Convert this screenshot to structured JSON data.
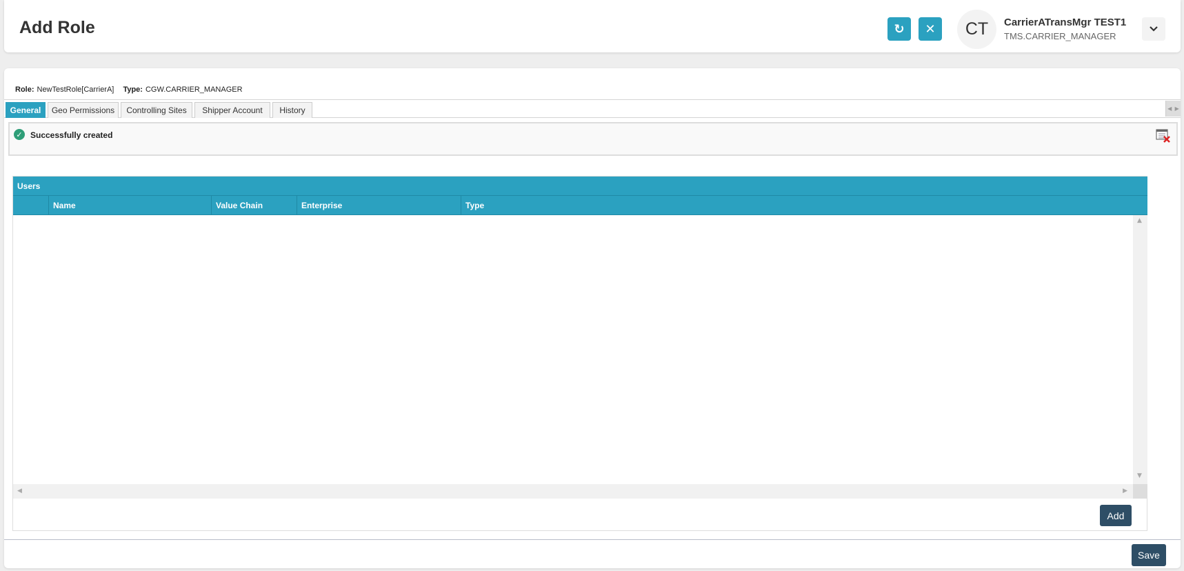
{
  "header": {
    "title": "Add Role",
    "refresh_icon": "refresh-icon",
    "close_icon": "close-icon",
    "user": {
      "initials": "CT",
      "name": "CarrierATransMgr TEST1",
      "role": "TMS.CARRIER_MANAGER"
    }
  },
  "info": {
    "role_label": "Role:",
    "role_value": "NewTestRole[CarrierA]",
    "type_label": "Type:",
    "type_value": "CGW.CARRIER_MANAGER"
  },
  "tabs": [
    {
      "label": "General",
      "active": true
    },
    {
      "label": "Geo Permissions"
    },
    {
      "label": "Controlling Sites"
    },
    {
      "label": "Shipper Account"
    },
    {
      "label": "History"
    }
  ],
  "message": {
    "text": "Successfully created"
  },
  "grid": {
    "title": "Users",
    "columns": [
      "",
      "Name",
      "Value Chain",
      "Enterprise",
      "Type"
    ],
    "rows": []
  },
  "buttons": {
    "add": "Add",
    "save": "Save"
  },
  "colors": {
    "accent": "#2ba1c0",
    "button_dark": "#2e4e66",
    "success": "#2e9e78"
  }
}
